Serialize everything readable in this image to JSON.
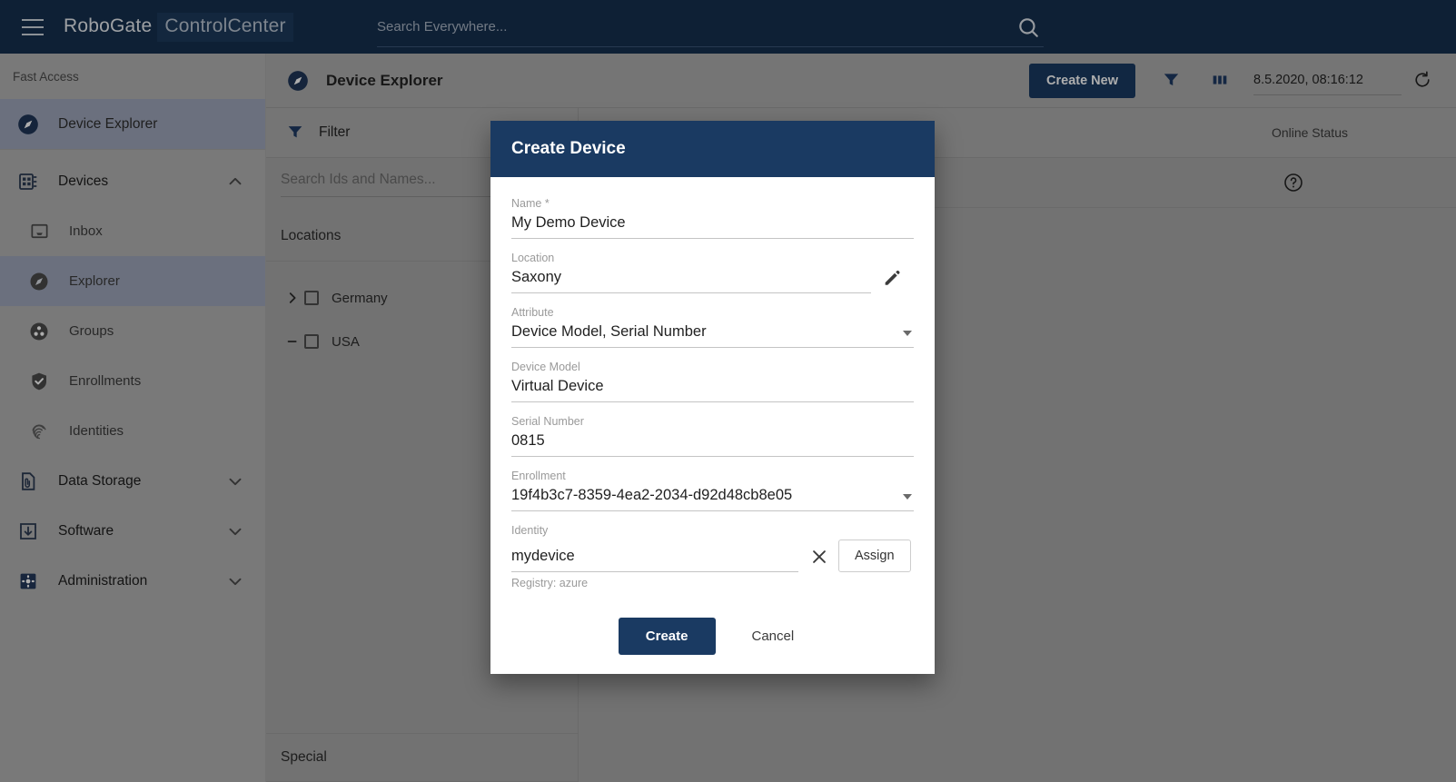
{
  "topbar": {
    "menu_icon": "hamburger-menu-icon",
    "brand_part1": "RoboGate",
    "brand_part2": "ControlCenter",
    "search_placeholder": "Search Everywhere...",
    "search_value": "",
    "search_icon": "search-icon"
  },
  "sidebar": {
    "section_label": "Fast Access",
    "fast_access": [
      {
        "label": "Device Explorer",
        "icon": "compass-icon",
        "active": true
      }
    ],
    "groups": [
      {
        "label": "Devices",
        "icon": "devices-board-icon",
        "expanded": true,
        "chevron": "chevron-up-icon",
        "children": [
          {
            "label": "Inbox",
            "icon": "inbox-tray-icon",
            "active": false
          },
          {
            "label": "Explorer",
            "icon": "compass-icon",
            "active": true
          },
          {
            "label": "Groups",
            "icon": "groups-dots-icon",
            "active": false
          },
          {
            "label": "Enrollments",
            "icon": "shield-check-icon",
            "active": false
          },
          {
            "label": "Identities",
            "icon": "fingerprint-icon",
            "active": false
          }
        ]
      },
      {
        "label": "Data Storage",
        "icon": "document-clip-icon",
        "expanded": false,
        "chevron": "chevron-down-icon",
        "children": []
      },
      {
        "label": "Software",
        "icon": "download-box-icon",
        "expanded": false,
        "chevron": "chevron-down-icon",
        "children": []
      },
      {
        "label": "Administration",
        "icon": "gear-square-icon",
        "expanded": false,
        "chevron": "chevron-down-icon",
        "children": []
      }
    ]
  },
  "page": {
    "title": "Device Explorer",
    "title_icon": "compass-icon",
    "actions": {
      "create_new_label": "Create New",
      "filter_icon": "funnel-filter-icon",
      "columns_icon": "columns-icon",
      "timestamp": "8.5.2020, 08:16:12",
      "refresh_icon": "refresh-icon"
    }
  },
  "filter_panel": {
    "header_label": "Filter",
    "header_icon": "funnel-filter-icon",
    "search_placeholder": "Search Ids and Names...",
    "locations_label": "Locations",
    "tree": [
      {
        "label": "Germany",
        "twisty": "chevron-right-icon",
        "checked": false
      },
      {
        "label": "USA",
        "twisty": "dash-icon",
        "checked": false
      }
    ],
    "special_label": "Special"
  },
  "table": {
    "columns": [
      "Online Status"
    ],
    "help_icon": "help-circle-icon"
  },
  "dialog": {
    "title": "Create Device",
    "fields": [
      {
        "key": "name",
        "label": "Name *",
        "value": "My Demo Device",
        "trailing": null,
        "caret": false
      },
      {
        "key": "location",
        "label": "Location",
        "value": "Saxony",
        "trailing": "edit-pencil-icon",
        "caret": false
      },
      {
        "key": "attribute",
        "label": "Attribute",
        "value": "Device Model, Serial Number",
        "trailing": null,
        "caret": true
      },
      {
        "key": "device_model",
        "label": "Device Model",
        "value": "Virtual Device",
        "trailing": null,
        "caret": false
      },
      {
        "key": "serial",
        "label": "Serial Number",
        "value": "0815",
        "trailing": null,
        "caret": false
      },
      {
        "key": "enrollment",
        "label": "Enrollment",
        "value": "19f4b3c7-8359-4ea2-2034-d92d48cb8e05",
        "trailing": null,
        "caret": true
      }
    ],
    "identity": {
      "label": "Identity",
      "value": "mydevice",
      "clear_icon": "close-x-icon",
      "assign_label": "Assign",
      "registry_note": "Registry: azure"
    },
    "create_label": "Create",
    "cancel_label": "Cancel"
  },
  "colors": {
    "brand_navy": "#16304f",
    "accent_navy": "#1a3a62",
    "surface_gray": "#a8a8a8",
    "sidebar_gray": "#b3b3b3",
    "sidebar_active": "#9ea6ba",
    "dialog_white": "#ffffff"
  }
}
